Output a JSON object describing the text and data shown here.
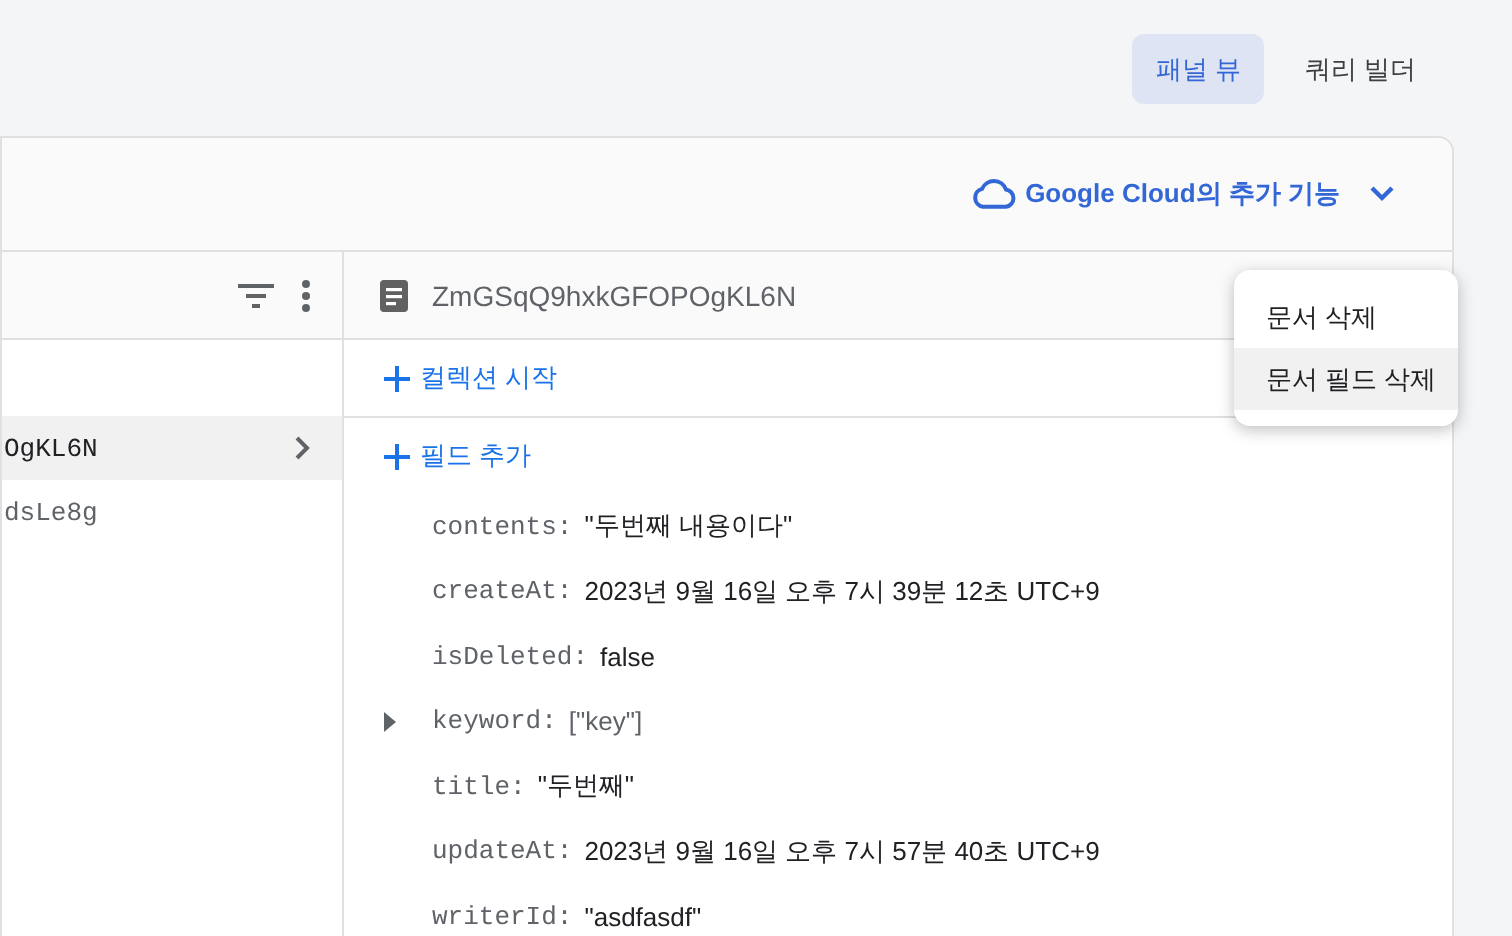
{
  "view_tabs": [
    {
      "label": "패널 뷰",
      "selected": true
    },
    {
      "label": "쿼리 빌더",
      "selected": false
    }
  ],
  "panel": {
    "cloud_link": "Google Cloud의 추가 기능"
  },
  "documents": [
    {
      "id": "OgKL6N",
      "selected": true
    },
    {
      "id": "dsLe8g",
      "selected": false
    }
  ],
  "document": {
    "title": "ZmGSqQ9hxkGFOPOgKL6N",
    "start_collection": "컬렉션 시작",
    "add_field": "필드 추가",
    "fields": [
      {
        "key": "contents:",
        "value": "\"두번째 내용이다\"",
        "kind": "value"
      },
      {
        "key": "createAt:",
        "value": "2023년 9월 16일 오후 7시 39분 12초 UTC+9",
        "kind": "value"
      },
      {
        "key": "isDeleted:",
        "value": "false",
        "kind": "value"
      },
      {
        "key": "keyword:",
        "value": "[\"key\"]",
        "kind": "array"
      },
      {
        "key": "title:",
        "value": "\"두번째\"",
        "kind": "value"
      },
      {
        "key": "updateAt:",
        "value": "2023년 9월 16일 오후 7시 57분 40초 UTC+9",
        "kind": "value"
      },
      {
        "key": "writerId:",
        "value": "\"asdfasdf\"",
        "kind": "value"
      }
    ]
  },
  "menu": [
    {
      "label": "문서 삭제",
      "highlighted": false
    },
    {
      "label": "문서 필드 삭제",
      "highlighted": true
    }
  ]
}
